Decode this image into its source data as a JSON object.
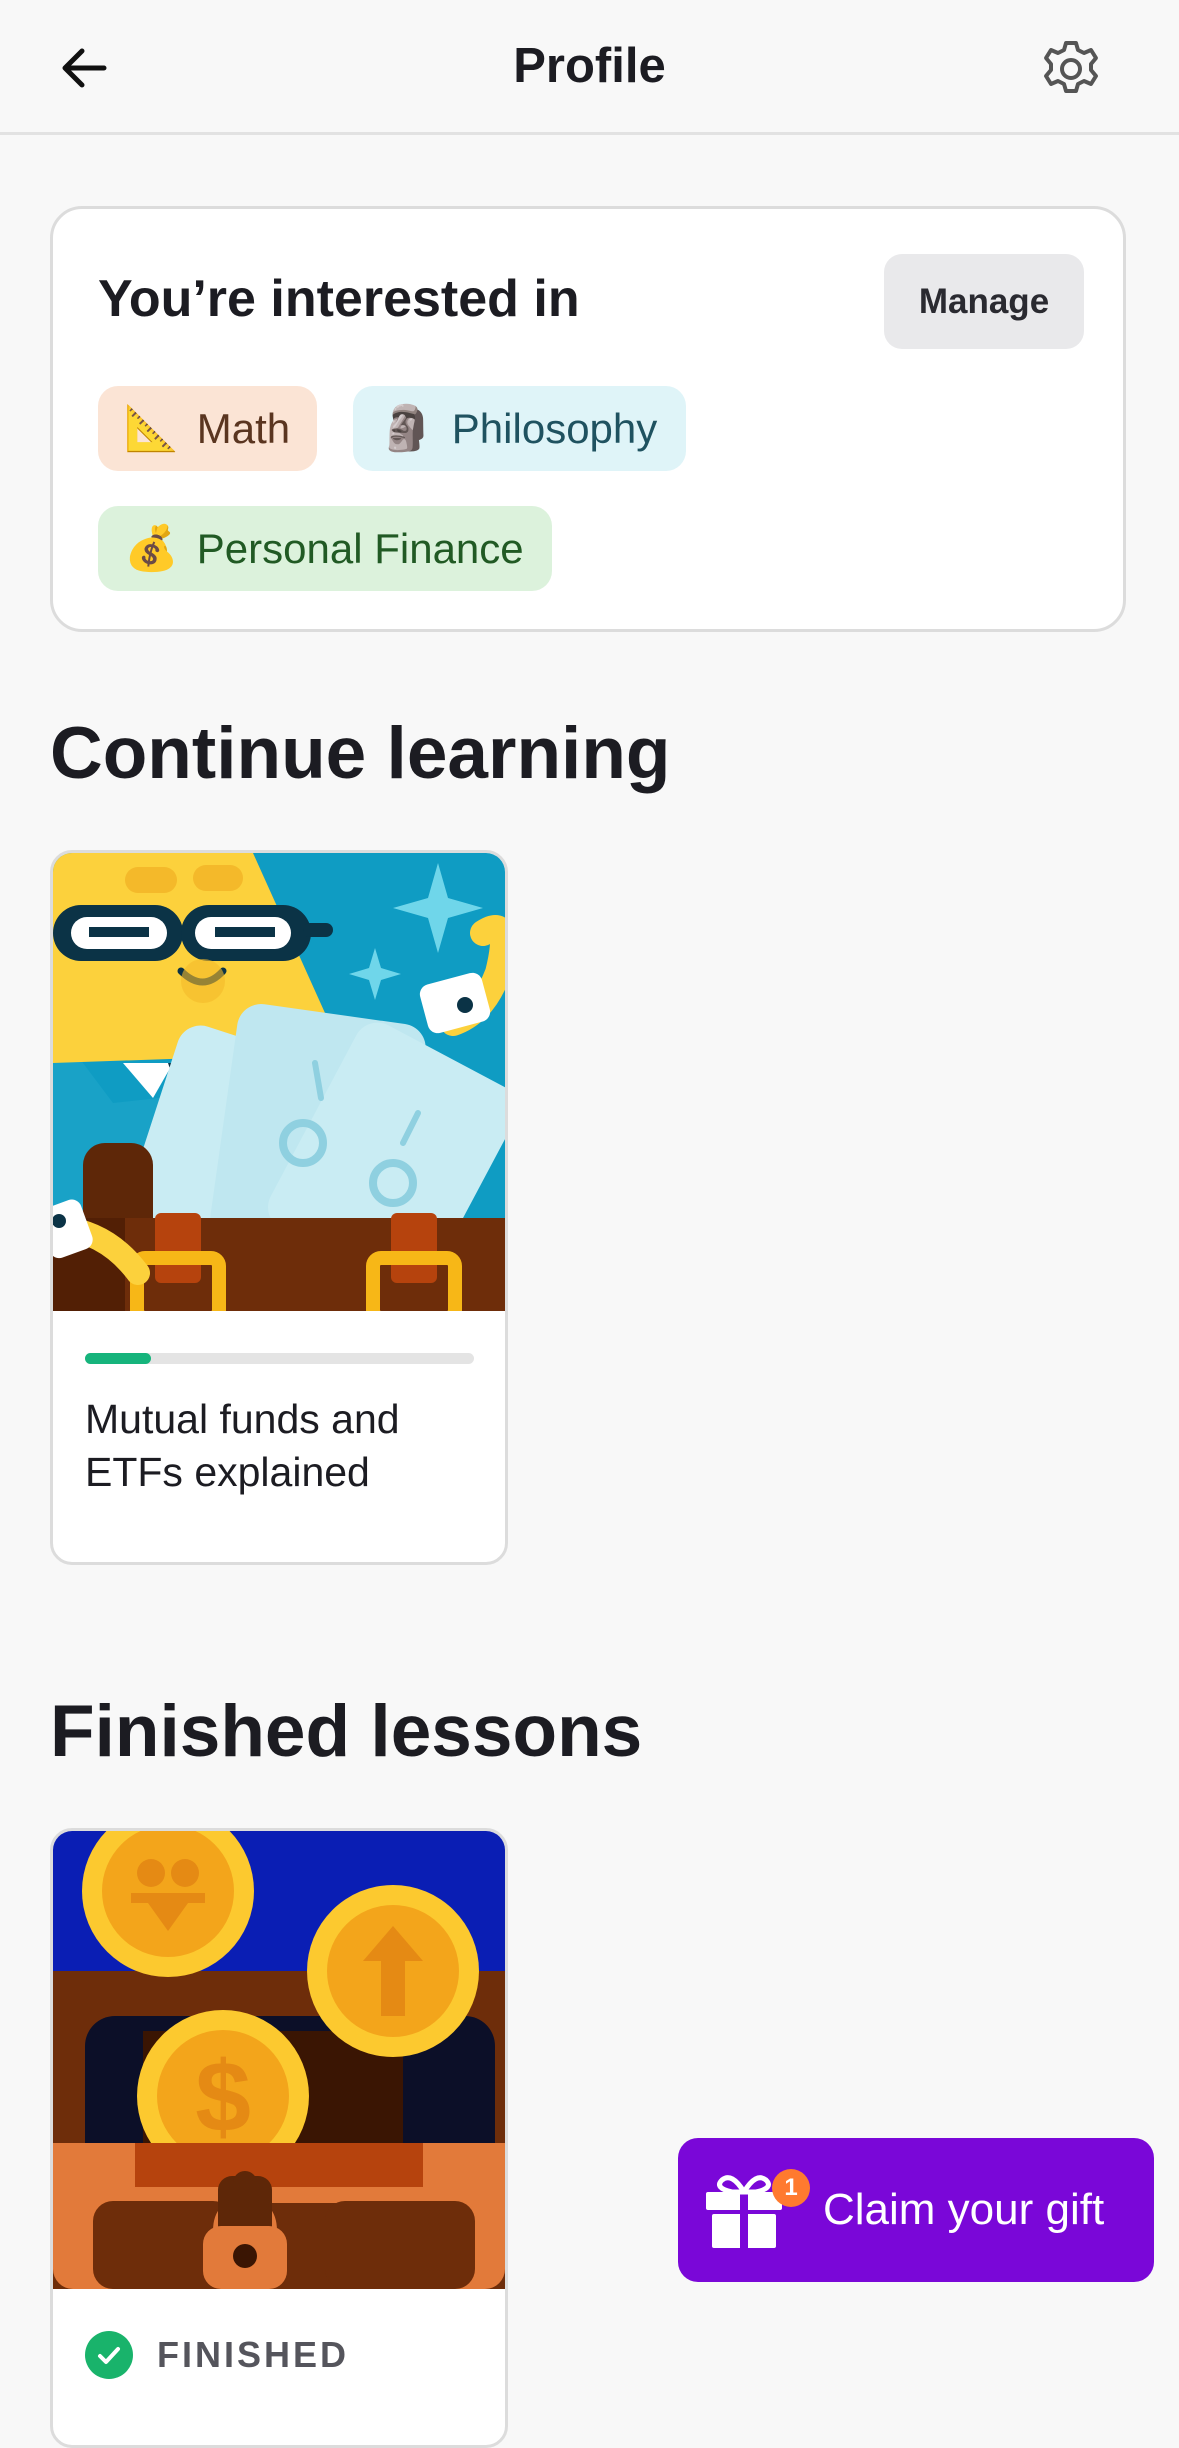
{
  "header": {
    "title": "Profile",
    "back_icon": "arrow-left-icon",
    "settings_icon": "gear-icon"
  },
  "interests": {
    "heading": "You’re interested in",
    "manage_label": "Manage",
    "topics": [
      {
        "emoji": "📐",
        "label": "Math",
        "color": "#fbe4d5"
      },
      {
        "emoji": "🗿",
        "label": "Philosophy",
        "color": "#dff4f8"
      },
      {
        "emoji": "💰",
        "label": "Personal Finance",
        "color": "#dcf2dc"
      }
    ]
  },
  "continue_learning": {
    "heading": "Continue learning",
    "lessons": [
      {
        "title": "Mutual funds and ETFs explained",
        "progress": 0.17,
        "progress_color": "#16b47c"
      }
    ]
  },
  "finished_lessons": {
    "heading": "Finished lessons",
    "lessons": [
      {
        "status": "FINISHED",
        "status_icon": "check-circle-icon"
      }
    ]
  },
  "gift": {
    "label": "Claim your gift",
    "badge_count": "1",
    "icon": "gift-icon",
    "color": "#7a07d8"
  }
}
